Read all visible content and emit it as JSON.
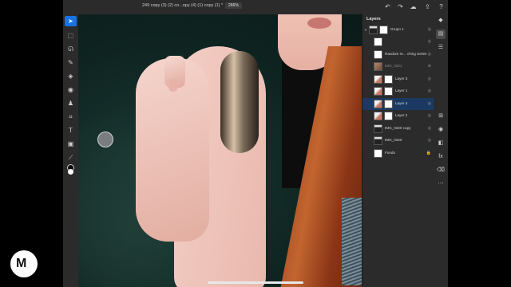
{
  "app": {
    "document_title": "249 copy (3) (2) co...opy (4) (1) copy (1) *",
    "zoom": "266%"
  },
  "icons": {
    "home": "home-icon",
    "undo": "undo-icon",
    "redo": "redo-icon",
    "cloud": "cloud-icon",
    "share": "share-icon",
    "help": "help-icon"
  },
  "tools": [
    {
      "name": "move-tool",
      "glyph": "➤",
      "active": true
    },
    {
      "name": "transform-tool",
      "glyph": "⬚"
    },
    {
      "name": "lasso-tool",
      "glyph": "ᘏ"
    },
    {
      "name": "brush-tool",
      "glyph": "✎"
    },
    {
      "name": "eraser-tool",
      "glyph": "◈"
    },
    {
      "name": "fill-tool",
      "glyph": "◉"
    },
    {
      "name": "clone-stamp-tool",
      "glyph": "♟"
    },
    {
      "name": "crop-tool",
      "glyph": "⌗"
    },
    {
      "name": "type-tool",
      "glyph": "T"
    },
    {
      "name": "place-image-tool",
      "glyph": "▣"
    },
    {
      "name": "eyedropper-tool",
      "glyph": "⟋"
    }
  ],
  "layers_panel": {
    "title": "Layers",
    "layers": [
      {
        "name": "Grupo 1",
        "thumb": "dark",
        "has_mask": true,
        "group": true,
        "visibility": "◎"
      },
      {
        "name": "",
        "thumb": "white",
        "has_mask": false,
        "dim": true,
        "visibility": "◎"
      },
      {
        "name": "Random re... ching series",
        "thumb": "white",
        "has_mask": false,
        "visibility": "◎"
      },
      {
        "name": "IMG_0321",
        "thumb": "photo",
        "has_mask": false,
        "dim": true,
        "visibility": "⊘"
      },
      {
        "name": "Layer 3",
        "thumb": "hair",
        "has_mask": true,
        "visibility": "◎"
      },
      {
        "name": "Layer 1",
        "thumb": "hair",
        "has_mask": true,
        "visibility": "◎"
      },
      {
        "name": "Layer 4",
        "thumb": "hair",
        "has_mask": true,
        "selected": true,
        "visibility": "◎"
      },
      {
        "name": "Layer 2",
        "thumb": "hair",
        "has_mask": true,
        "visibility": "◎"
      },
      {
        "name": "IMG_0320 copy",
        "thumb": "dark",
        "has_mask": false,
        "visibility": "◎"
      },
      {
        "name": "IMG_0320",
        "thumb": "dark",
        "has_mask": false,
        "visibility": "◎"
      },
      {
        "name": "Fondo",
        "thumb": "white",
        "has_mask": false,
        "locked": true,
        "visibility": "🔒"
      }
    ]
  },
  "right_tools": [
    {
      "name": "layers-icon",
      "glyph": "◆"
    },
    {
      "name": "layer-properties-icon",
      "glyph": "▤",
      "active": true
    },
    {
      "name": "adjustments-icon",
      "glyph": "☰"
    },
    {
      "name": "add-layer-icon",
      "glyph": "⊞"
    },
    {
      "name": "visibility-icon",
      "glyph": "◉"
    },
    {
      "name": "mask-icon",
      "glyph": "◧"
    },
    {
      "name": "effects-icon",
      "glyph": "fx"
    },
    {
      "name": "clear-icon",
      "glyph": "⌫"
    },
    {
      "name": "more-icon",
      "glyph": "⋯"
    }
  ],
  "colors": {
    "accent": "#1473e6",
    "selected_layer": "#1b3a63",
    "panel": "#2b2b2b"
  }
}
